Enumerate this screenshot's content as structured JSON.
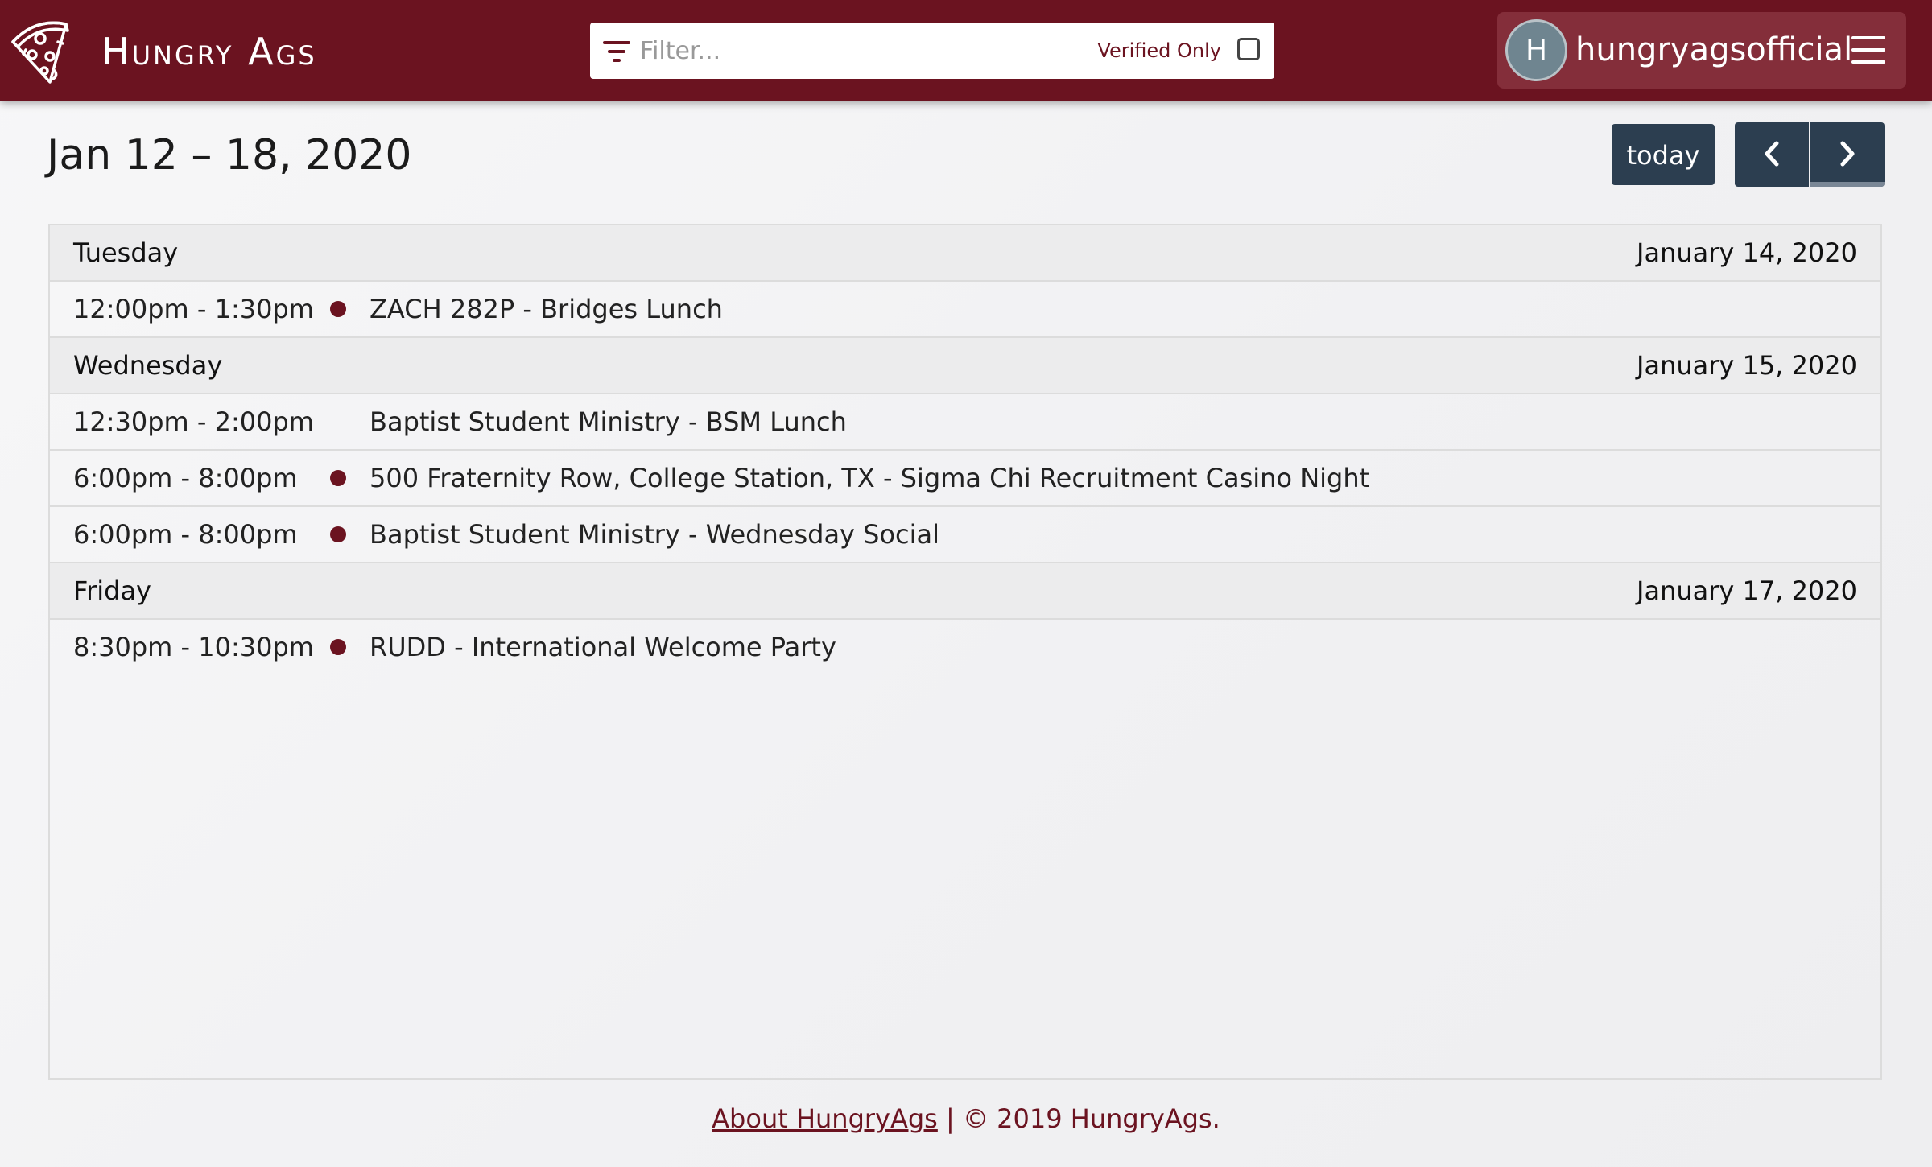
{
  "navbar": {
    "brand": "Hungry Ags",
    "logo_icon": "pizza-slice-icon",
    "filter": {
      "icon": "filter-icon",
      "placeholder": "Filter...",
      "value": "",
      "verified_label": "Verified Only",
      "verified_checked": false
    },
    "user": {
      "avatar_initial": "H",
      "username": "hungryagsofficial",
      "menu_icon": "hamburger-menu-icon"
    }
  },
  "calendar": {
    "title": "Jan 12 – 18, 2020",
    "today_label": "today",
    "prev_icon": "chevron-left-icon",
    "next_icon": "chevron-right-icon",
    "days": [
      {
        "name": "Tuesday",
        "date": "January 14, 2020",
        "events": [
          {
            "time": "12:00pm - 1:30pm",
            "title": "ZACH 282P - Bridges Lunch",
            "dot": true
          }
        ]
      },
      {
        "name": "Wednesday",
        "date": "January 15, 2020",
        "events": [
          {
            "time": "12:30pm - 2:00pm",
            "title": "Baptist Student Ministry - BSM Lunch",
            "dot": false
          },
          {
            "time": "6:00pm - 8:00pm",
            "title": "500 Fraternity Row, College Station, TX - Sigma Chi Recruitment Casino Night",
            "dot": true
          },
          {
            "time": "6:00pm - 8:00pm",
            "title": "Baptist Student Ministry - Wednesday Social",
            "dot": true
          }
        ]
      },
      {
        "name": "Friday",
        "date": "January 17, 2020",
        "events": [
          {
            "time": "8:30pm - 10:30pm",
            "title": "RUDD - International Welcome Party",
            "dot": true
          }
        ]
      }
    ]
  },
  "footer": {
    "about_link": "About HungryAgs",
    "copyright": " | © 2019 HungryAgs."
  },
  "colors": {
    "brand": "#6b1320",
    "button": "#2c3e50",
    "user_box": "#842e3a",
    "event_dot": "#6b1320"
  }
}
